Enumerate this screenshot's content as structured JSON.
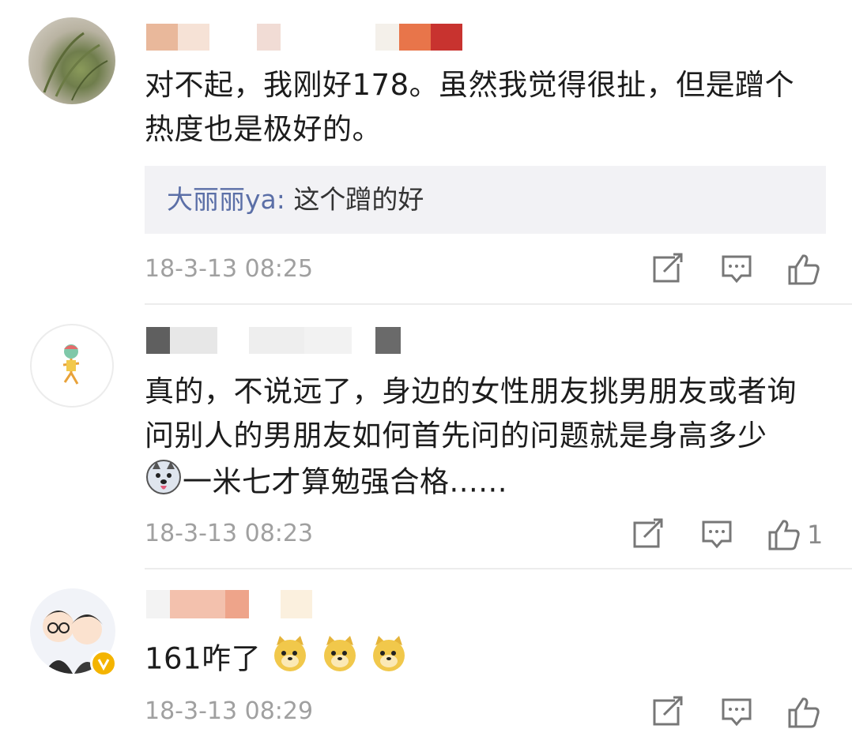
{
  "comments": [
    {
      "text_line1": "对不起，我刚好178。虽然我觉得很扯，但是蹭个",
      "text_line2": "热度也是极好的。",
      "reply": {
        "name": "大丽丽ya",
        "sep": ":",
        "text": " 这个蹭的好"
      },
      "timestamp": "18-3-13 08:25",
      "likes": ""
    },
    {
      "text_line1": "真的，不说远了，身边的女性朋友挑男朋友或者询",
      "text_line2": "问别人的男朋友如何首先问的问题就是身高多少",
      "text_line3": "一米七才算勉强合格......",
      "emoji": "husky-emoji",
      "timestamp": "18-3-13 08:23",
      "likes": "1"
    },
    {
      "text": "161咋了",
      "emojis": [
        "doge-emoji",
        "doge-emoji",
        "doge-emoji"
      ],
      "timestamp": "18-3-13 08:29",
      "likes": ""
    }
  ],
  "icons": [
    "repost-icon",
    "comment-icon",
    "like-icon"
  ],
  "colors": {
    "reply_name": "#5b6fa7",
    "timestamp": "#a0a0a0",
    "reply_bg": "#f2f2f5"
  }
}
